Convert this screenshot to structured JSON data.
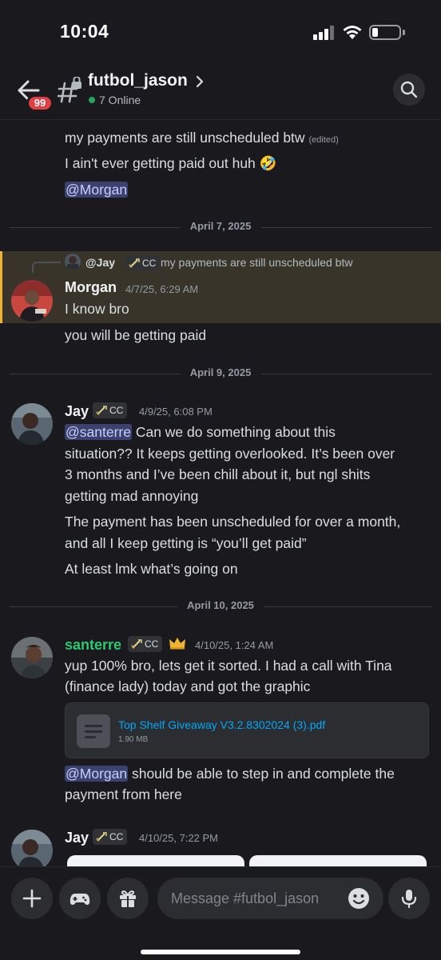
{
  "status_bar": {
    "time": "10:04"
  },
  "header": {
    "unread_badge": "99",
    "channel_name": "futbol_jason",
    "online_text": "7 Online"
  },
  "messages": {
    "m1": {
      "line1": "my payments are still unscheduled btw",
      "edited": "(edited)",
      "line2": "I ain't ever getting paid out huh 🤣",
      "mention": "@Morgan"
    },
    "divider1": "April 7, 2025",
    "m2": {
      "reply_name": "@Jay",
      "reply_role": "CC",
      "reply_text": "my payments are still unscheduled btw",
      "username": "Morgan",
      "timestamp": "4/7/25, 6:29 AM",
      "line1": "I know bro",
      "line2": "you will be getting paid"
    },
    "divider2": "April 9, 2025",
    "m3": {
      "username": "Jay",
      "role": "CC",
      "timestamp": "4/9/25, 6:08 PM",
      "mention": "@santerre",
      "line1_rest": " Can we do something about this",
      "line2": "situation?? It keeps getting overlooked. It’s been over",
      "line3": "3 months and I’ve been chill about it, but ngl shits",
      "line4": "getting mad annoying",
      "line5": "The payment has been unscheduled for over a month,",
      "line6": "and all I keep getting is “you’ll get paid”",
      "line7": "At least lmk what’s going on"
    },
    "divider3": "April 10, 2025",
    "m4": {
      "username": "santerre",
      "role": "CC",
      "timestamp": "4/10/25, 1:24 AM",
      "line1": "yup 100% bro, lets get it sorted. I had a call with Tina",
      "line2": "(finance lady) today and got the graphic",
      "file_name": "Top Shelf Giveaway V3.2.8302024 (3).pdf",
      "file_size": "1.90 MB",
      "mention": "@Morgan",
      "line3_rest": " should be able to step in and complete the",
      "line4": "payment from here"
    },
    "m5": {
      "username": "Jay",
      "role": "CC",
      "timestamp": "4/10/25, 7:22 PM"
    }
  },
  "composer": {
    "placeholder": "Message #futbol_jason"
  },
  "colors": {
    "background": "#1a1a1e",
    "mention_bg": "#3c4270",
    "highlight_bg": "#38342a",
    "highlight_bar": "#f0b232",
    "online_green": "#23a55a",
    "santerre_name": "#2dc770",
    "link_blue": "#00a8fc",
    "badge_red": "#e23f44"
  },
  "icons": [
    "back-arrow-icon",
    "private-channel-icon",
    "chevron-right-icon",
    "search-icon",
    "role-sword-icon",
    "crown-icon",
    "file-icon",
    "scroll-down-icon",
    "plus-icon",
    "gamepad-icon",
    "gift-icon",
    "emoji-icon",
    "microphone-icon"
  ]
}
